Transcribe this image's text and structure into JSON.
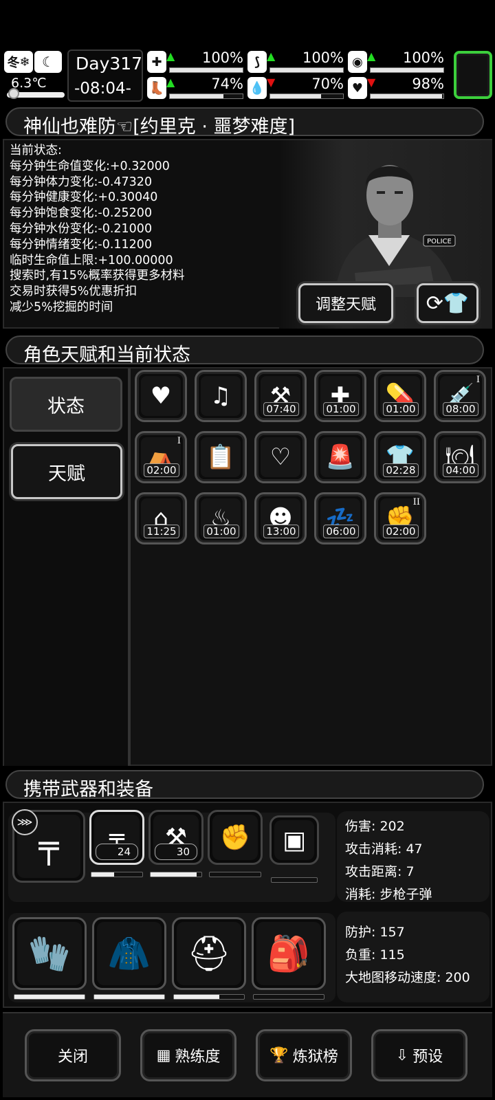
{
  "hud": {
    "season": "冬",
    "temperature": "6.3℃",
    "day": "Day317",
    "time": "-08:04-",
    "stats": [
      {
        "icon": "medkit-icon",
        "glyph": "✚",
        "arrow": "up",
        "value": "100%",
        "level": 1.0
      },
      {
        "icon": "stomach-icon",
        "glyph": "⟆",
        "arrow": "up",
        "value": "100%",
        "level": 1.0
      },
      {
        "icon": "mood-icon",
        "glyph": "◉",
        "arrow": "up",
        "value": "100%",
        "level": 1.0
      },
      {
        "icon": "boot-icon",
        "glyph": "👢",
        "arrow": "up",
        "value": "74%",
        "level": 0.74
      },
      {
        "icon": "water-drop-icon",
        "glyph": "💧",
        "arrow": "down",
        "value": "70%",
        "level": 0.7
      },
      {
        "icon": "heart-icon",
        "glyph": "♥",
        "arrow": "down",
        "value": "98%",
        "level": 0.98
      }
    ]
  },
  "character": {
    "title": "神仙也难防☜[约里克 · 噩梦难度]",
    "status_lines": [
      "当前状态:",
      "每分钟生命值变化:+0.32000",
      "每分钟体力变化:-0.47320",
      "每分钟健康变化:+0.30040",
      "每分钟饱食变化:-0.25200",
      "每分钟水份变化:-0.21000",
      "每分钟情绪变化:-0.11200",
      "临时生命值上限:+100.00000",
      "搜索时,有15%概率获得更多材料",
      "交易时获得5%优惠折扣",
      "减少5%挖掘的时间"
    ],
    "adjust_talent_button": "调整天赋",
    "portrait_badge": "POLICE"
  },
  "talents_panel": {
    "title": "角色天赋和当前状态",
    "tabs": [
      "状态",
      "天赋"
    ],
    "items": [
      {
        "icon": "heart-icon",
        "glyph": "♥",
        "time": ""
      },
      {
        "icon": "music-heart-icon",
        "glyph": "♫",
        "time": ""
      },
      {
        "icon": "toolbox-up-icon",
        "glyph": "⚒",
        "time": "07:40"
      },
      {
        "icon": "medical-plus-icon",
        "glyph": "✚",
        "time": "01:00"
      },
      {
        "icon": "pill-icon",
        "glyph": "💊",
        "time": "01:00"
      },
      {
        "icon": "syringe-up-icon",
        "glyph": "💉",
        "time": "08:00",
        "lvl": "I"
      },
      {
        "icon": "bed-up-icon",
        "glyph": "⛺",
        "time": "02:00",
        "lvl": "I"
      },
      {
        "icon": "clipboard-pill-icon",
        "glyph": "📋",
        "time": ""
      },
      {
        "icon": "stomach-heart-icon",
        "glyph": "♡",
        "time": ""
      },
      {
        "icon": "alarm-light-icon",
        "glyph": "🚨",
        "time": ""
      },
      {
        "icon": "shirt-icon",
        "glyph": "👕",
        "time": "02:28"
      },
      {
        "icon": "plate-heart-icon",
        "glyph": "🍽",
        "time": "04:00"
      },
      {
        "icon": "house-question-icon",
        "glyph": "⌂",
        "time": "11:25"
      },
      {
        "icon": "heat-waves-icon",
        "glyph": "♨",
        "time": "01:00"
      },
      {
        "icon": "zombie-face-icon",
        "glyph": "☻",
        "time": "13:00"
      },
      {
        "icon": "sleeping-person-icon",
        "glyph": "💤",
        "time": "06:00"
      },
      {
        "icon": "fist-icon",
        "glyph": "✊",
        "time": "02:00",
        "lvl": "II"
      }
    ]
  },
  "equipment": {
    "title": "携带武器和装备",
    "weapons": [
      {
        "icon": "assault-rifle-icon",
        "glyph": "╤",
        "count": ""
      },
      {
        "icon": "rifle-icon",
        "glyph": "╤",
        "count": "24",
        "level": 0.45
      },
      {
        "icon": "hammer-icon",
        "glyph": "⚒",
        "count": "30",
        "level": 0.9
      },
      {
        "icon": "fist-weapon-icon",
        "glyph": "✊",
        "count": "",
        "level": 0
      },
      {
        "icon": "riot-shield-icon",
        "glyph": "▣",
        "count": "",
        "level": 0
      }
    ],
    "weapon_stats": [
      "伤害: 202",
      "攻击消耗: 47",
      "攻击距离: 7",
      "消耗: 步枪子弹"
    ],
    "armor": [
      {
        "icon": "gauntlets-icon",
        "glyph": "🧤",
        "level": 1.0
      },
      {
        "icon": "fur-coat-icon",
        "glyph": "🧥",
        "level": 1.0
      },
      {
        "icon": "tactical-helmet-icon",
        "glyph": "⛑",
        "level": 0.65
      },
      {
        "icon": "backpack-icon",
        "glyph": "🎒",
        "level": 0
      }
    ],
    "armor_stats": [
      "防护: 157",
      "负重: 115",
      "大地图移动速度: 200"
    ]
  },
  "bottom_buttons": [
    {
      "label": "关闭",
      "icon": ""
    },
    {
      "label": "熟练度",
      "icon": "skill-board-icon"
    },
    {
      "label": "炼狱榜",
      "icon": "trophy-banner-icon"
    },
    {
      "label": "预设",
      "icon": "preset-box-icon"
    }
  ]
}
